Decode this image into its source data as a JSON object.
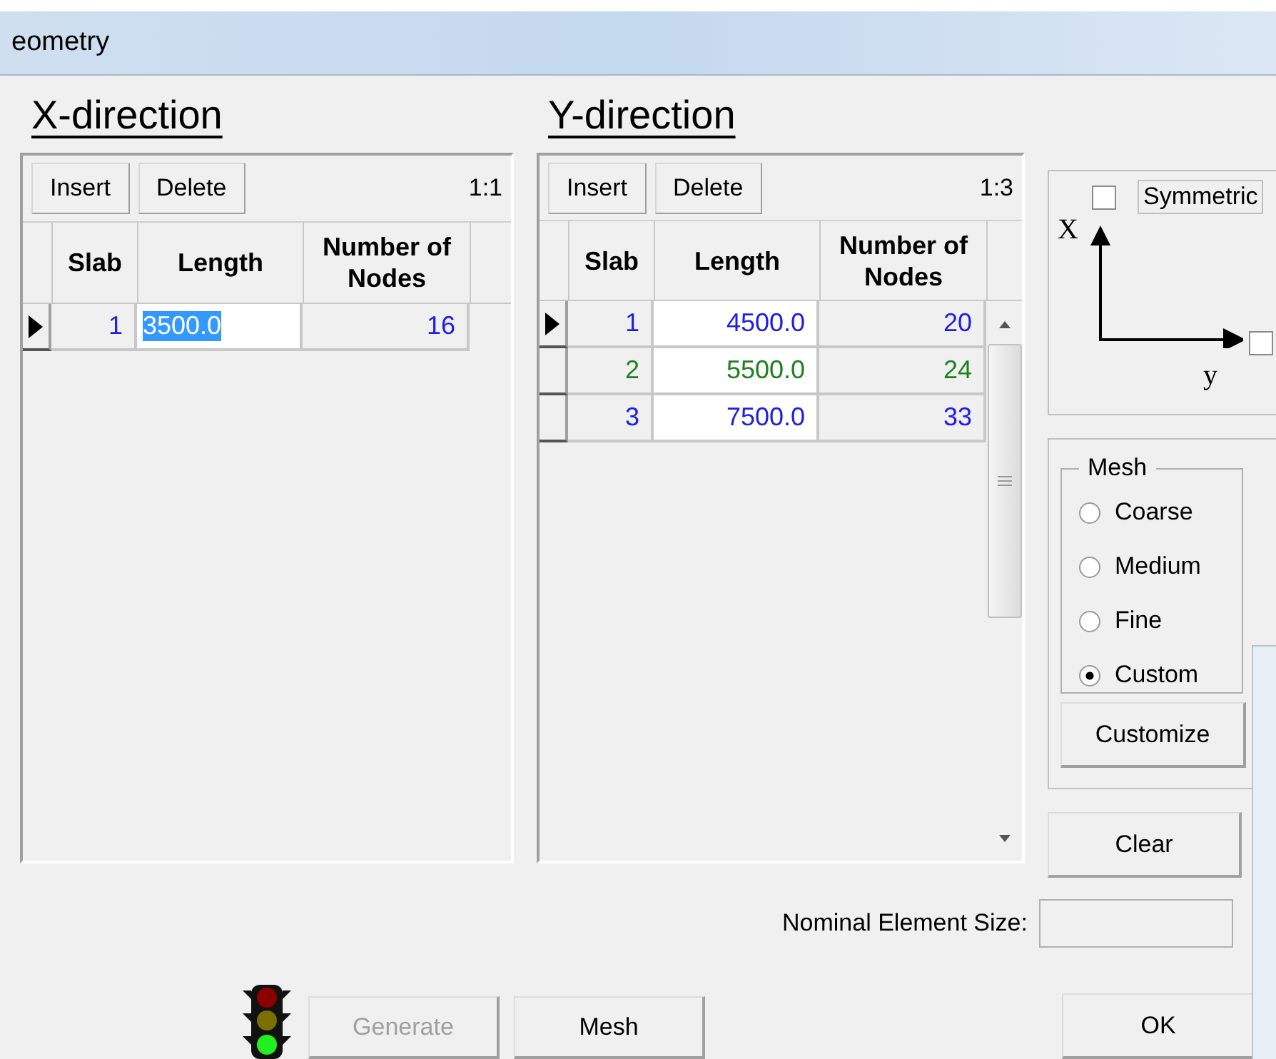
{
  "window": {
    "title": "eometry"
  },
  "x_direction": {
    "heading": "X-direction",
    "insert": "Insert",
    "delete": "Delete",
    "position": "1:1",
    "columns": [
      "Slab",
      "Length",
      "Number of Nodes"
    ],
    "rows": [
      {
        "slab": "1",
        "length": "3500.0",
        "nodes": "16",
        "color": "#2020e0",
        "selected": true,
        "editing": true
      }
    ]
  },
  "y_direction": {
    "heading": "Y-direction",
    "insert": "Insert",
    "delete": "Delete",
    "position": "1:3",
    "columns": [
      "Slab",
      "Length",
      "Number of Nodes"
    ],
    "rows": [
      {
        "slab": "1",
        "length": "4500.0",
        "nodes": "20",
        "color": "#2020e0",
        "selected": true,
        "editing": false
      },
      {
        "slab": "2",
        "length": "5500.0",
        "nodes": "24",
        "color": "#208020",
        "selected": false,
        "editing": false
      },
      {
        "slab": "3",
        "length": "7500.0",
        "nodes": "33",
        "color": "#2020e0",
        "selected": false,
        "editing": false
      }
    ]
  },
  "axes": {
    "x_label": "X",
    "y_label": "y",
    "symmetric_label": "Symmetric",
    "symmetric_checked": false,
    "y_checked": false
  },
  "mesh": {
    "title": "Mesh",
    "options": [
      {
        "label": "Coarse",
        "selected": false
      },
      {
        "label": "Medium",
        "selected": false
      },
      {
        "label": "Fine",
        "selected": false
      },
      {
        "label": "Custom",
        "selected": true
      }
    ],
    "customize": "Customize"
  },
  "clear": "Clear",
  "nominal_element_size": {
    "label": "Nominal Element Size:"
  },
  "buttons": [
    {
      "label": "Generate",
      "disabled": true
    },
    {
      "label": "Mesh",
      "disabled": false
    }
  ],
  "ok": "OK"
}
